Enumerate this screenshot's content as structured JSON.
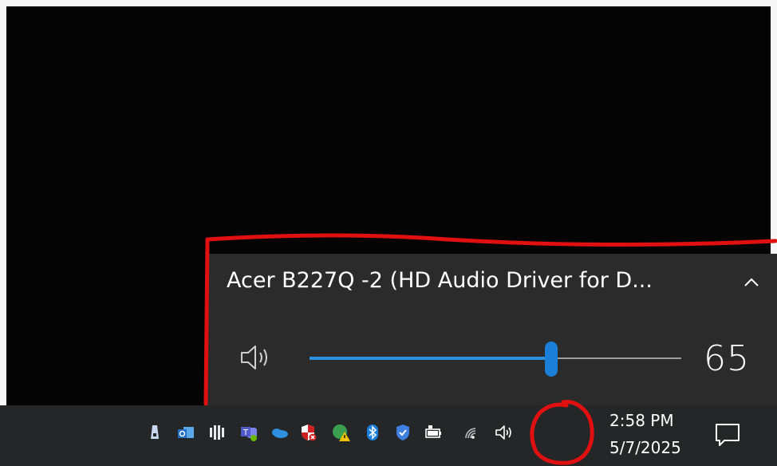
{
  "volume_flyout": {
    "device_name": "Acer B227Q -2 (HD Audio Driver for D...",
    "expand_icon": "chevron-up-icon",
    "speaker_icon": "speaker-icon",
    "volume": 65,
    "volume_label": "65",
    "accent": "#1b7fd9"
  },
  "tray_icons": [
    "pen-icon",
    "outlook-icon",
    "audio-equalizer-icon",
    "teams-icon",
    "onedrive-icon",
    "security-shield-icon",
    "warning-app-icon",
    "bluetooth-icon",
    "defender-shield-icon",
    "battery-icon",
    "wifi-icon",
    "speaker-icon"
  ],
  "clock": {
    "time": "2:58 PM",
    "date": "5/7/2025"
  },
  "notification_icon": "notification-icon",
  "annotation_color": "#e01010"
}
